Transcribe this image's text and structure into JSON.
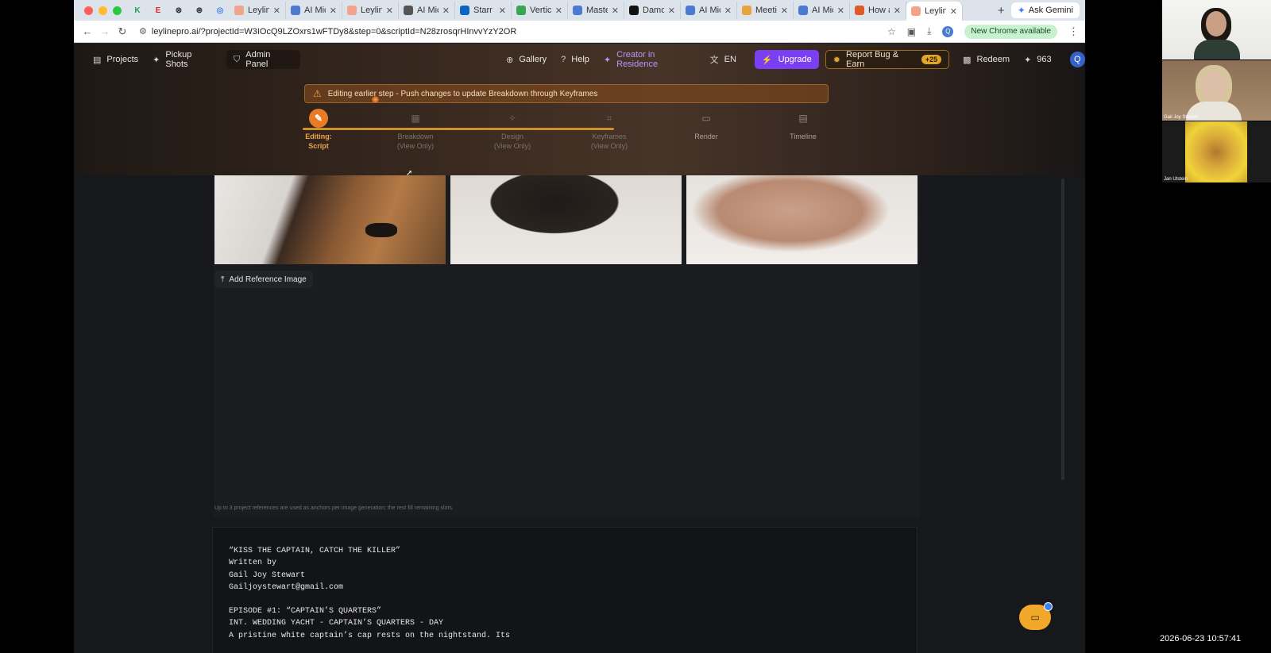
{
  "browser": {
    "pinned": [
      {
        "icon": "k-icon",
        "glyph": "K",
        "color": "#1f9d55"
      },
      {
        "icon": "e-icon",
        "glyph": "E",
        "color": "#e0282e"
      },
      {
        "icon": "openai-icon",
        "glyph": "⊗",
        "color": "#333333"
      },
      {
        "icon": "chatgpt-icon",
        "glyph": "⊛",
        "color": "#333333"
      },
      {
        "icon": "chrome-icon",
        "glyph": "◎",
        "color": "#4285f4"
      }
    ],
    "tabs": [
      {
        "label": "Leyline",
        "icon": "leyline-icon",
        "color": "#f2a38a"
      },
      {
        "label": "AI Micr",
        "icon": "docs-icon",
        "color": "#4a7bd0"
      },
      {
        "label": "Leyline",
        "icon": "leyline-icon",
        "color": "#f2a38a"
      },
      {
        "label": "AI Micr",
        "icon": "openai-icon",
        "color": "#555555"
      },
      {
        "label": "Starr K",
        "icon": "linkedin-icon",
        "color": "#0a66c2"
      },
      {
        "label": "Vertica",
        "icon": "drive-icon",
        "color": "#34a853"
      },
      {
        "label": "Master",
        "icon": "docs-icon",
        "color": "#4a7bd0"
      },
      {
        "label": "Damon",
        "icon": "notion-icon",
        "color": "#111111"
      },
      {
        "label": "AI Micr",
        "icon": "ai-icon",
        "color": "#4a7bd0"
      },
      {
        "label": "Meetin",
        "icon": "folder-icon",
        "color": "#e8a33a"
      },
      {
        "label": "AI Micr",
        "icon": "ai-icon",
        "color": "#4a7bd0"
      },
      {
        "label": "How a",
        "icon": "howa-icon",
        "color": "#e0592a"
      },
      {
        "label": "Leyline",
        "icon": "leyline-icon",
        "color": "#f2a38a",
        "active": true
      }
    ],
    "ask_gemini": "Ask Gemini",
    "url": "leylinepro.ai/?projectId=W3IOcQ9LZOxrs1wFTDy8&step=0&scriptId=N28zrosqrHInvvYzY2OR",
    "new_chrome": "New Chrome available",
    "profile_initial": "Q"
  },
  "nav": {
    "projects": "Projects",
    "pickup_shots": "Pickup Shots",
    "admin_panel": "Admin Panel",
    "gallery": "Gallery",
    "help": "Help",
    "creator": "Creator in Residence",
    "language": "EN",
    "upgrade": "Upgrade",
    "report": "Report Bug & Earn",
    "report_badge": "+25",
    "redeem": "Redeem",
    "credits": "963",
    "user_initial": "Q"
  },
  "warning": "Editing earlier step - Push changes to update Breakdown through Keyframes",
  "steps": [
    {
      "label": "Editing:",
      "sub": "Script",
      "icon": "pencil-icon",
      "glyph": "✎",
      "state": "active"
    },
    {
      "label": "Breakdown",
      "sub": "(View Only)",
      "icon": "breakdown-icon",
      "glyph": "▦",
      "state": "dim"
    },
    {
      "label": "Design",
      "sub": "(View Only)",
      "icon": "design-icon",
      "glyph": "✧",
      "state": "dim"
    },
    {
      "label": "Keyframes",
      "sub": "(View Only)",
      "icon": "crop-icon",
      "glyph": "⌗",
      "state": "dim"
    },
    {
      "label": "Render",
      "sub": "",
      "icon": "clapper-icon",
      "glyph": "▭",
      "state": "normal"
    },
    {
      "label": "Timeline",
      "sub": "",
      "icon": "film-icon",
      "glyph": "▤",
      "state": "normal"
    }
  ],
  "references": {
    "add_label": "Add Reference Image",
    "hint": "Up to 3 project references are used as anchors per image generation; the rest fill remaining slots."
  },
  "script_lines": [
    "“KISS THE CAPTAIN, CATCH THE KILLER”",
    "Written by",
    "Gail Joy Stewart",
    "Gailjoystewart@gmail.com",
    "",
    "EPISODE #1: “CAPTAIN’S QUARTERS”",
    "INT. WEDDING YACHT - CAPTAIN’S QUARTERS - DAY",
    "A pristine white captain’s cap rests on the nightstand. Its"
  ],
  "participants": {
    "second": "Gail Joy Stewart",
    "third": "Jan Utstein"
  },
  "clock": "2026-06-23 10:57:41",
  "colors": {
    "accent_orange": "#ea7b25",
    "upgrade_purple": "#7b3ff2",
    "creator_purple": "#b19af6"
  }
}
